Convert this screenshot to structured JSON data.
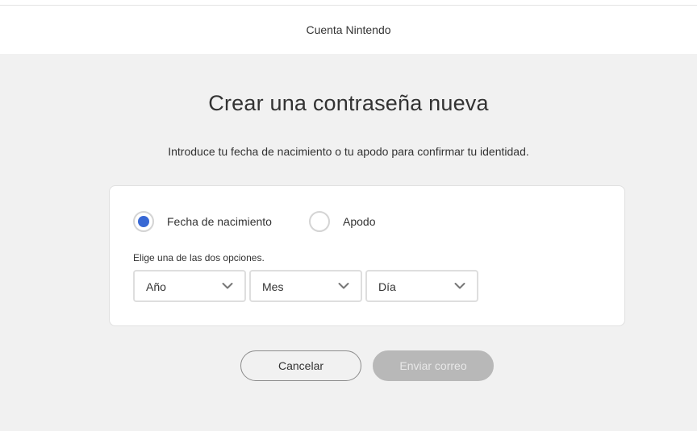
{
  "header": {
    "brand": "Cuenta Nintendo"
  },
  "main": {
    "title": "Crear una contraseña nueva",
    "subtitle": "Introduce tu fecha de nacimiento o tu apodo para confirmar tu identidad.",
    "options": [
      {
        "label": "Fecha de nacimiento",
        "checked": true
      },
      {
        "label": "Apodo",
        "checked": false
      }
    ],
    "hint": "Elige una de las dos opciones.",
    "selects": [
      {
        "value": "Año"
      },
      {
        "value": "Mes"
      },
      {
        "value": "Día"
      }
    ],
    "buttons": {
      "cancel": "Cancelar",
      "send": "Enviar correo"
    }
  },
  "colors": {
    "accent": "#3868d4",
    "background": "#f1f1f1",
    "disabled_button": "#b8b8b8"
  },
  "icons": {
    "select_arrow": "chevron-down-icon"
  }
}
